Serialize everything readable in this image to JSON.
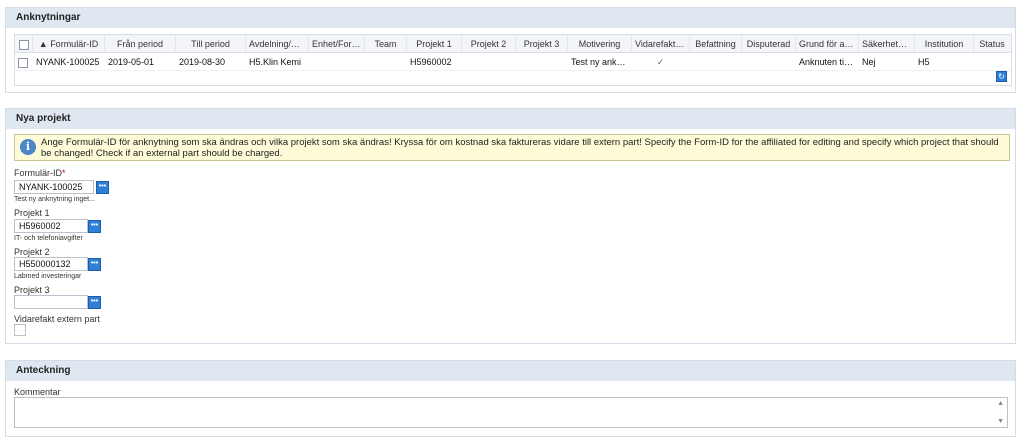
{
  "affiliations": {
    "title": "Anknytningar",
    "columns": [
      "",
      "▲ Formulär-ID",
      "Från period",
      "Till period",
      "Avdelning/Ce...",
      "Enhet/Fors...",
      "Team",
      "Projekt 1",
      "Projekt 2",
      "Projekt 3",
      "Motivering",
      "Vidarefaktu...",
      "Befattning",
      "Disputerad",
      "Grund för ank...",
      "Säkerhetst...",
      "Institution",
      "Status"
    ],
    "rows": [
      [
        "",
        "NYANK-100025",
        "2019-05-01",
        "2019-08-30",
        "H5.Klin Kemi",
        "",
        "",
        "H5960002",
        "",
        "",
        "Test ny ankn...",
        "✓",
        "",
        "",
        "Anknuten till...",
        "Nej",
        "H5",
        ""
      ]
    ]
  },
  "new_projects": {
    "title": "Nya projekt",
    "info_text": "Ange Formulär-ID för anknytning som ska ändras och vilka projekt som ska ändras! Kryssa för om kostnad ska faktureras vidare till extern part! Specify the Form-ID for the affiliated for editing and specify which project that should be changed! Check if an external part should be charged.",
    "form_id": {
      "label": "Formulär-ID",
      "required_mark": "*",
      "value": "NYANK-100025",
      "sub": "Test ny anknytning inget..."
    },
    "project1": {
      "label": "Projekt 1",
      "value": "H5960002",
      "sub": "IT- och telefoniavgifter"
    },
    "project2": {
      "label": "Projekt 2",
      "value": "H550000132",
      "sub": "Labmed investeringar"
    },
    "project3": {
      "label": "Projekt 3",
      "value": ""
    },
    "external": {
      "label": "Vidarefakt extern part"
    }
  },
  "note": {
    "title": "Anteckning",
    "comment_label": "Kommentar"
  },
  "icons": {
    "lookup": "lookup-icon",
    "refresh": "refresh-icon",
    "info": "info-icon"
  }
}
